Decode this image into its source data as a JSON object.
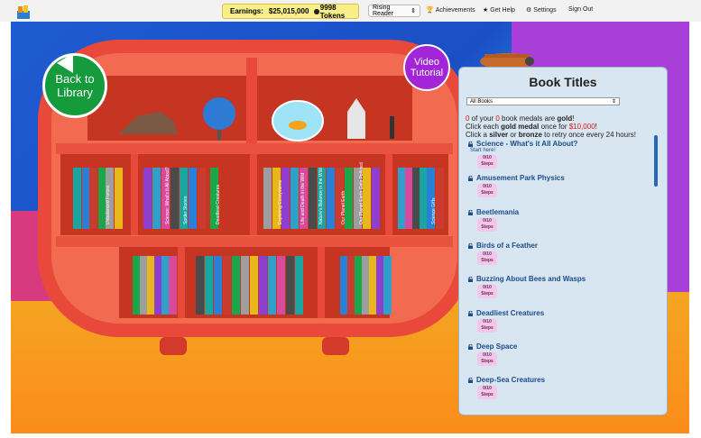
{
  "topbar": {
    "earnings_label": "Earnings:",
    "earnings_value": "$25,015,000",
    "tokens": "9998 Tokens",
    "level": "Rising Reader",
    "nav": [
      "Achievements",
      "Get Help",
      "Settings",
      "Sign Out"
    ]
  },
  "buttons": {
    "back": [
      "Back to",
      "Library"
    ],
    "video": [
      "Video",
      "Tutorial"
    ]
  },
  "panel": {
    "title": "Book Titles",
    "filter": "All Books",
    "medal_prefix_a": "0",
    "medal_text_a": " of your ",
    "medal_prefix_b": "0",
    "medal_text_b": " book medals are ",
    "medal_gold": "gold",
    "medal_end": "!",
    "line2_a": "Click each ",
    "line2_gold": "gold medal",
    "line2_b": " once for ",
    "line2_amt": "$10,000",
    "line2_c": "!",
    "line3_a": "Click a ",
    "line3_silver": "silver",
    "line3_b": " or ",
    "line3_bronze": "bronze",
    "line3_c": " to retry once every 24 hours!",
    "start_here": "Start here!",
    "items": [
      {
        "title": "Science - What's it All About?",
        "steps": "0/10",
        "unit": "Steps"
      },
      {
        "title": "Amusement Park Physics",
        "steps": "0/10",
        "unit": "Steps"
      },
      {
        "title": "Beetlemania",
        "steps": "0/10",
        "unit": "Steps"
      },
      {
        "title": "Birds of a Feather",
        "steps": "0/10",
        "unit": "Steps"
      },
      {
        "title": "Buzzing About Bees and Wasps",
        "steps": "0/10",
        "unit": "Steps"
      },
      {
        "title": "Deadliest Creatures",
        "steps": "0/10",
        "unit": "Steps"
      },
      {
        "title": "Deep Space",
        "steps": "0/10",
        "unit": "Steps"
      },
      {
        "title": "Deep-Sea Creatures",
        "steps": "0/10",
        "unit": "Steps"
      }
    ]
  },
  "books": {
    "spines": [
      "Unbalanced Forces",
      "Science: What's It All About?",
      "Spider Stories",
      "Deadliest Creatures",
      "Exploring Ecosystems",
      "Life and Death in the Wild",
      "Nature's Balance in the Wild",
      "Our Planet Earth",
      "Our Planet Earth Gets Polluted",
      "Science Gifts"
    ]
  },
  "colors": {
    "shelf": "#e8493a",
    "accent_green": "#159a3c",
    "accent_purple": "#a225d8",
    "topbar_yellow": "#f8ef8a",
    "title_blue": "#1d4a8a"
  }
}
